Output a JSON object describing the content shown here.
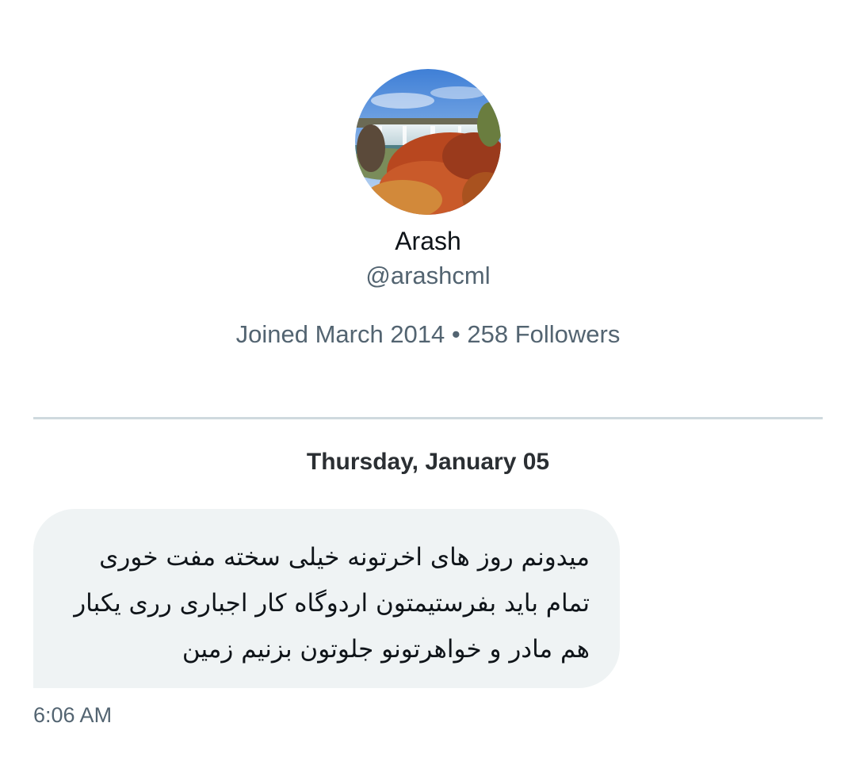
{
  "profile": {
    "avatar_icon": "waterfall-photo-avatar",
    "display_name": "Arash",
    "handle": "@arashcml",
    "joined": "Joined March 2014",
    "separator": "•",
    "followers": "258 Followers"
  },
  "conversation": {
    "date_header": "Thursday, January 05",
    "messages": [
      {
        "text": "میدونم روز های اخرتونه خیلی سخته مفت خوری\nتمام باید بفرستیمتون اردوگاه کار اجباری رری یکبار\nهم مادر و خواهرتونو جلوتون بزنیم زمین",
        "time": "6:06 AM"
      }
    ]
  },
  "colors": {
    "primary_text": "#0f1419",
    "secondary_text": "#536471",
    "bubble_bg": "#eff3f4",
    "divider": "#cfd9de"
  }
}
